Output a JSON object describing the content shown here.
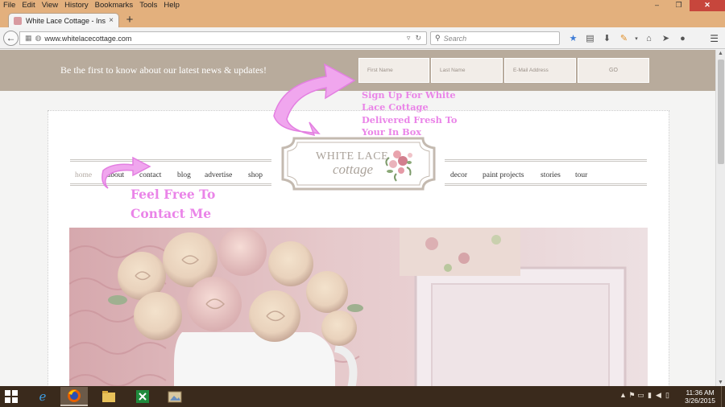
{
  "browser": {
    "menu": [
      "File",
      "Edit",
      "View",
      "History",
      "Bookmarks",
      "Tools",
      "Help"
    ],
    "window_controls": {
      "minimize": "–",
      "restore": "❐",
      "close": "✕"
    },
    "tab": {
      "title": "White Lace Cottage - Inspir...",
      "close": "×"
    },
    "new_tab": "+",
    "url": "www.whitelacecottage.com",
    "search_placeholder": "Search",
    "toolbar_icons": [
      "bookmark-star-icon",
      "bookmarks-menu-icon",
      "downloads-icon",
      "pencil-icon",
      "home-icon",
      "send-icon",
      "chat-icon",
      "menu-icon"
    ]
  },
  "page": {
    "signup": {
      "text": "Be the first to know about our latest news & updates!",
      "first_name": "First Name",
      "last_name": "Last Name",
      "email": "E-Mail Address",
      "go": "GO"
    },
    "nav_left": [
      "home",
      "about",
      "contact",
      "blog",
      "advertise",
      "shop"
    ],
    "nav_right": [
      "decor",
      "paint projects",
      "stories",
      "tour"
    ],
    "logo": {
      "line1": "WHITE LACE",
      "line2": "cottage"
    },
    "annotations": {
      "signup": "Sign Up For White Lace Cottage Delivered Fresh To Your In Box",
      "contact_line1": "Feel Free To",
      "contact_line2": "Contact Me"
    },
    "colors": {
      "header_band": "#b8ab9c",
      "annotation": "#ea84e8",
      "firefox_chrome": "#e3b07d"
    }
  },
  "taskbar": {
    "apps": [
      "internet-explorer-icon",
      "firefox-icon",
      "file-explorer-icon",
      "excel-icon",
      "photos-icon"
    ],
    "time": "11:36 AM",
    "date": "3/26/2015"
  }
}
